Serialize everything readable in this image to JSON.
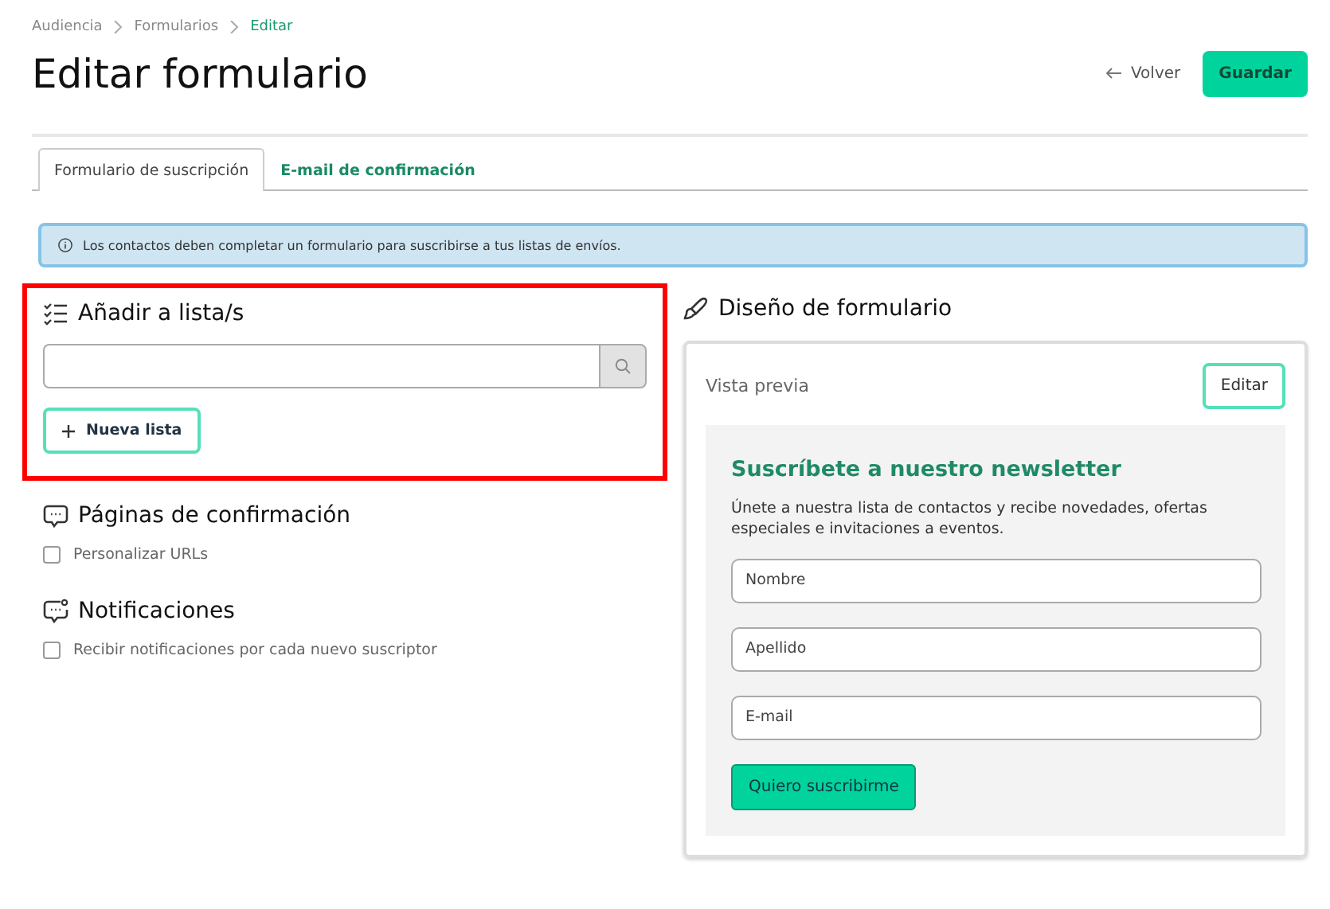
{
  "breadcrumb": [
    {
      "label": "Audiencia",
      "current": false
    },
    {
      "label": "Formularios",
      "current": false
    },
    {
      "label": "Editar",
      "current": true
    }
  ],
  "title": "Editar formulario",
  "actions": {
    "back": "Volver",
    "save": "Guardar"
  },
  "tabs": [
    {
      "label": "Formulario de suscripción",
      "selected": true
    },
    {
      "label": "E-mail de confirmación",
      "selected": false
    }
  ],
  "info": "Los contactos deben completar un formulario para suscribirse a tus listas de envíos.",
  "lists_section": {
    "title": "Añadir a lista/s",
    "highlighted": true,
    "new_list_button": "Nueva lista"
  },
  "options": [
    {
      "title": "Páginas de confirmación",
      "checkbox": {
        "label": "Personalizar URLs",
        "checked": false
      }
    },
    {
      "title": "Notificaciones",
      "checkbox": {
        "label": "Recibir notificaciones por cada nuevo suscriptor",
        "checked": false
      }
    }
  ],
  "design": {
    "title": "Diseño de formulario",
    "preview_label": "Vista previa",
    "edit_button": "Editar",
    "preview": {
      "heading": "Suscríbete a nuestro newsletter",
      "text": "Únete a nuestra lista de contactos y recibe novedades, ofertas especiales e invitaciones a eventos.",
      "fields": [
        {
          "placeholder": "Nombre"
        },
        {
          "placeholder": "Apellido"
        },
        {
          "placeholder": "E-mail"
        }
      ],
      "submit": "Quiero suscribirme"
    }
  }
}
